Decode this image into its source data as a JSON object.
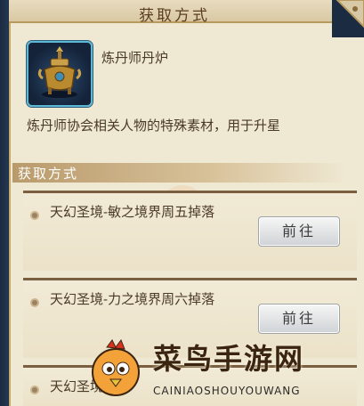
{
  "dialog": {
    "title": "获取方式"
  },
  "item": {
    "name": "炼丹师丹炉",
    "description": "炼丹师协会相关人物的特殊素材，用于升星",
    "icon": "alchemy-furnace-icon"
  },
  "section": {
    "title": "获取方式"
  },
  "routes": [
    {
      "text": "天幻圣境-敏之境界周五掉落",
      "button": "前往"
    },
    {
      "text": "天幻圣境-力之境界周六掉落",
      "button": "前往"
    },
    {
      "text": "天幻圣境-",
      "button": ""
    }
  ],
  "watermark": {
    "title": "菜鸟手游网",
    "subtitle": "CAINIAOSHOUYOUWANG"
  },
  "colors": {
    "panel": "#efe8d3",
    "title_text": "#5a3d22",
    "frame": "#1d2a3c",
    "icon_border": "#5fb7d6"
  }
}
